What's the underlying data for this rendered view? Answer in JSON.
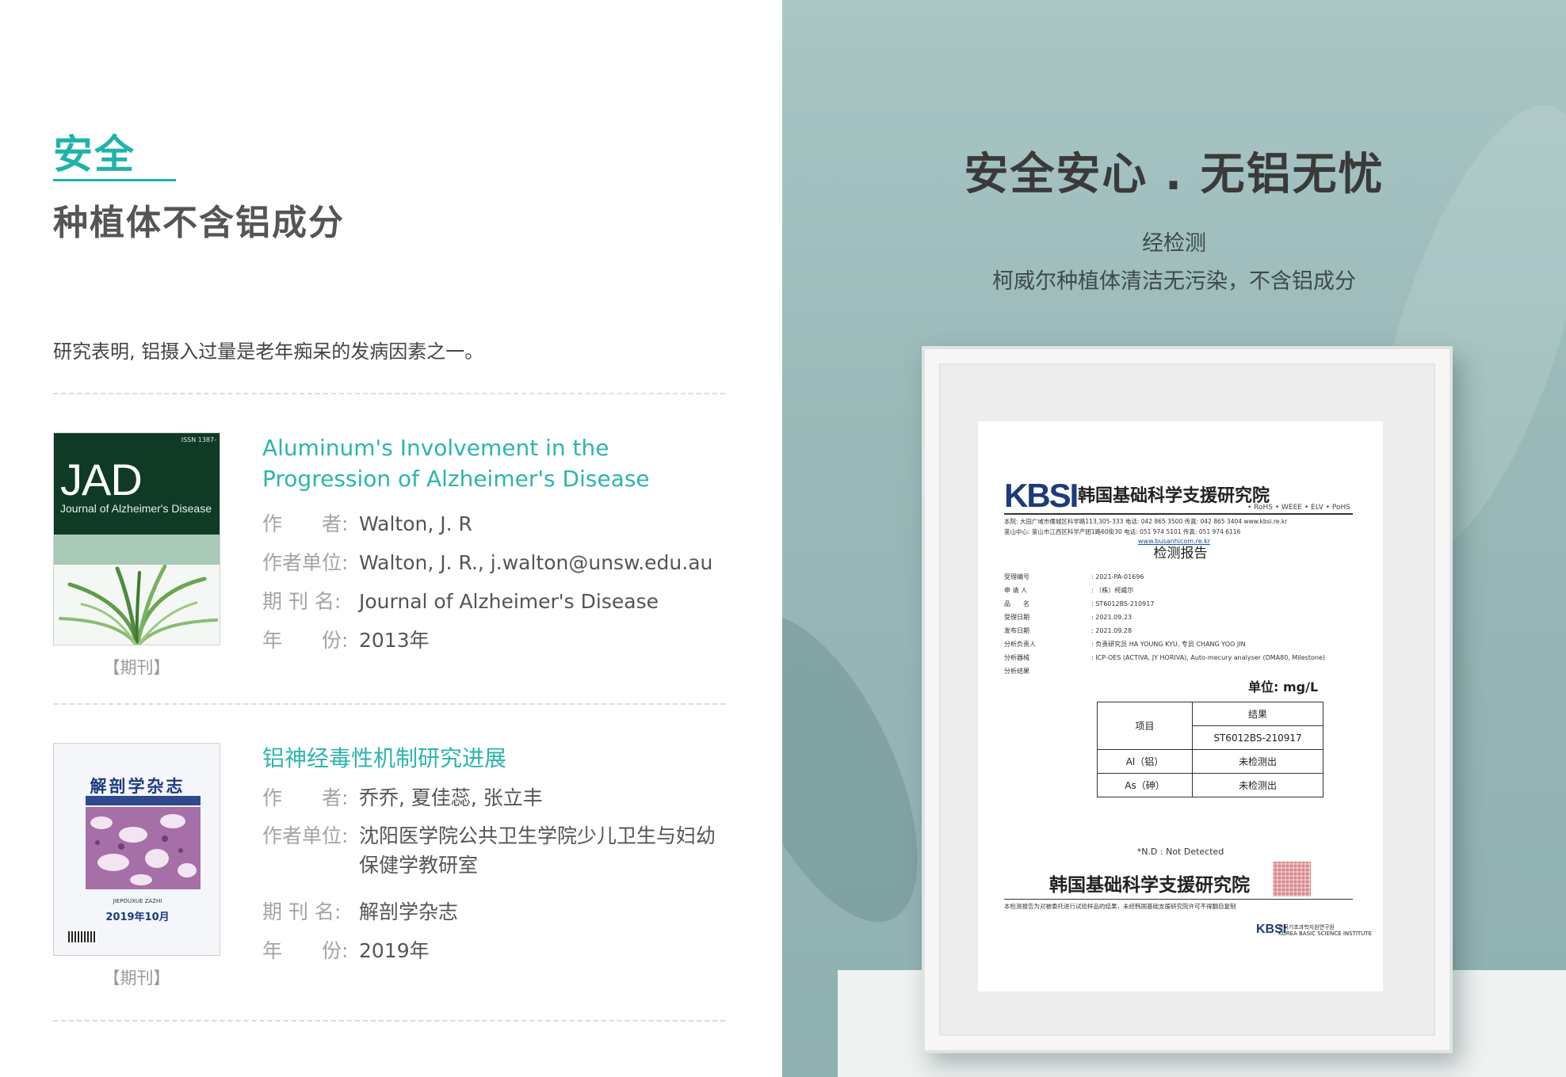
{
  "left": {
    "kicker": "安全",
    "headline": "种植体不含铝成分",
    "lead": "研究表明, 铝摄入过量是老年痴呆的发病因素之一。",
    "articles": [
      {
        "title": "Aluminum's Involvement in the Progression of Alzheimer's Disease",
        "author_label": "作　　者:",
        "author": "Walton, J. R",
        "affil_label": "作者单位:",
        "affil": "Walton, J. R., j.walton@unsw.edu.au",
        "journal_label": "期 刊 名:",
        "journal": "Journal of Alzheimer's Disease",
        "year_label": "年　　份:",
        "year": "2013年",
        "tag": "【期刊】",
        "cover": {
          "issn": "ISSN 1387-",
          "abbr": "JAD",
          "subtitle": "Journal of Alzheimer's Disease"
        }
      },
      {
        "title": "铝神经毒性机制研究进展",
        "author_label": "作　　者:",
        "author": "乔乔,  夏佳蕊,  张立丰",
        "affil_label": "作者单位:",
        "affil": "沈阳医学院公共卫生学院少儿卫生与妇幼",
        "affil_cont": "保健学教研室",
        "journal_label": "期 刊 名:",
        "journal": "解剖学杂志",
        "year_label": "年　　份:",
        "year": "2019年",
        "tag": "【期刊】",
        "cover": {
          "title": "解剖学杂志",
          "pinyin": "JIEPOUXUE ZAZHI",
          "date": "2019年10月"
        }
      }
    ]
  },
  "right": {
    "headline": "安全安心 . 无铝无忧",
    "sub1": "经检测",
    "sub2": "柯威尔种植体清洁无污染，不含铝成分",
    "certificate": {
      "logo": "KBSI",
      "institute": "韩国基础科学支援研究院",
      "tags": "• RoHS • WEEE • ELV • PoHS",
      "addr1": "本院: 大田广域市儒城区科学路113,305-333    电话: 042 865 3500    传真: 042 865 3404    www.kbsi.re.kr",
      "addr2": "釜山中心: 釜山市江西区科学产团1路60街30    电话: 051 974 5101    传真: 051 974 6116",
      "link": "www.busanhicom.re.kr",
      "report_title": "检测报告",
      "fields": [
        {
          "label": "受理编号",
          "value": ": 2021-PA-01696"
        },
        {
          "label": "申 请 人",
          "value": ": （株）柯威尔"
        },
        {
          "label": "品　　名",
          "value": ": ST6012BS-210917"
        },
        {
          "label": "受理日期",
          "value": ": 2021.09.23"
        },
        {
          "label": "发布日期",
          "value": ": 2021.09.28"
        },
        {
          "label": "分析负责人",
          "value": ": 负责研究员 HA YOUNG KYU, 专员 CHANG YOO JIN"
        },
        {
          "label": "分析器械",
          "value": ": ICP-OES (ACTIVA, JY HORIVA), Auto-mecury analyser (DMA80, Milestone)"
        },
        {
          "label": "分析结果",
          "value": ""
        }
      ],
      "unit": "单位: mg/L",
      "table": {
        "col_item": "项目",
        "col_result": "结果",
        "sample": "ST6012BS-210917",
        "rows": [
          {
            "item": "Al（铝）",
            "result": "未检测出"
          },
          {
            "item": "As（砷）",
            "result": "未检测出"
          }
        ]
      },
      "nd_note": "*N.D : Not Detected",
      "signature": "韩国基础科学支援研究院",
      "footer": "本检测报告为对被委托进行试验样品的结果，未经韩国基础支援研究院许可不得翻自复制",
      "logo_small": "KBSI",
      "logo_small_ko": "한국기초과학지원연구원",
      "logo_small_en": "KOREA BASIC SCIENCE INSTITUTE"
    }
  }
}
